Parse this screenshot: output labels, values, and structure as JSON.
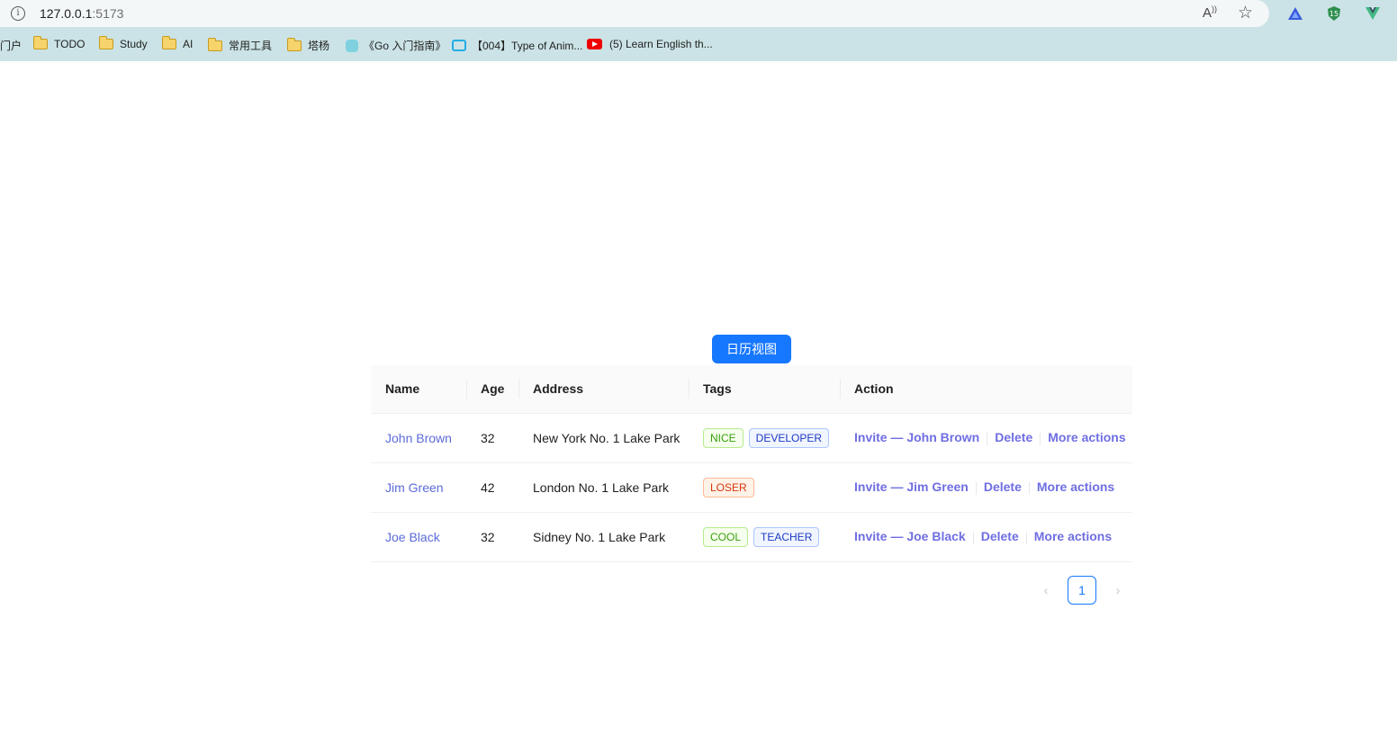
{
  "browser": {
    "url_host": "127.0.0.1",
    "url_port": ":5173",
    "bookmarks": [
      {
        "label": "门户",
        "icon": "none"
      },
      {
        "label": "TODO",
        "icon": "folder-icon"
      },
      {
        "label": "Study",
        "icon": "folder-icon"
      },
      {
        "label": "AI",
        "icon": "folder-icon"
      },
      {
        "label": "常用工具",
        "icon": "folder-icon"
      },
      {
        "label": "塔杨",
        "icon": "folder-icon"
      },
      {
        "label": "《Go 入门指南》",
        "icon": "gopher-icon"
      },
      {
        "label": "【004】Type of Anim...",
        "icon": "bilibili-icon"
      },
      {
        "label": "(5) Learn English th...",
        "icon": "youtube-icon"
      }
    ]
  },
  "calendar_button_label": "日历视图",
  "table": {
    "columns": [
      "Name",
      "Age",
      "Address",
      "Tags",
      "Action"
    ],
    "rows": [
      {
        "name": "John Brown",
        "age": "32",
        "address": "New York No. 1 Lake Park",
        "tags": [
          "NICE",
          "DEVELOPER"
        ],
        "invite": "Invite — John Brown",
        "delete": "Delete",
        "more": "More actions"
      },
      {
        "name": "Jim Green",
        "age": "42",
        "address": "London No. 1 Lake Park",
        "tags": [
          "LOSER"
        ],
        "invite": "Invite — Jim Green",
        "delete": "Delete",
        "more": "More actions"
      },
      {
        "name": "Joe Black",
        "age": "32",
        "address": "Sidney No. 1 Lake Park",
        "tags": [
          "COOL",
          "TEACHER"
        ],
        "invite": "Invite — Joe Black",
        "delete": "Delete",
        "more": "More actions"
      }
    ]
  },
  "tag_colors": {
    "NICE": "#52c41a",
    "DEVELOPER": "#2f54eb",
    "LOSER": "#d4380d",
    "COOL": "#52c41a",
    "TEACHER": "#2f54eb"
  },
  "pagination": {
    "prev": "‹",
    "current": "1",
    "next": "›"
  },
  "colors": {
    "primary": "#1677ff",
    "link": "#5c6bd9"
  }
}
